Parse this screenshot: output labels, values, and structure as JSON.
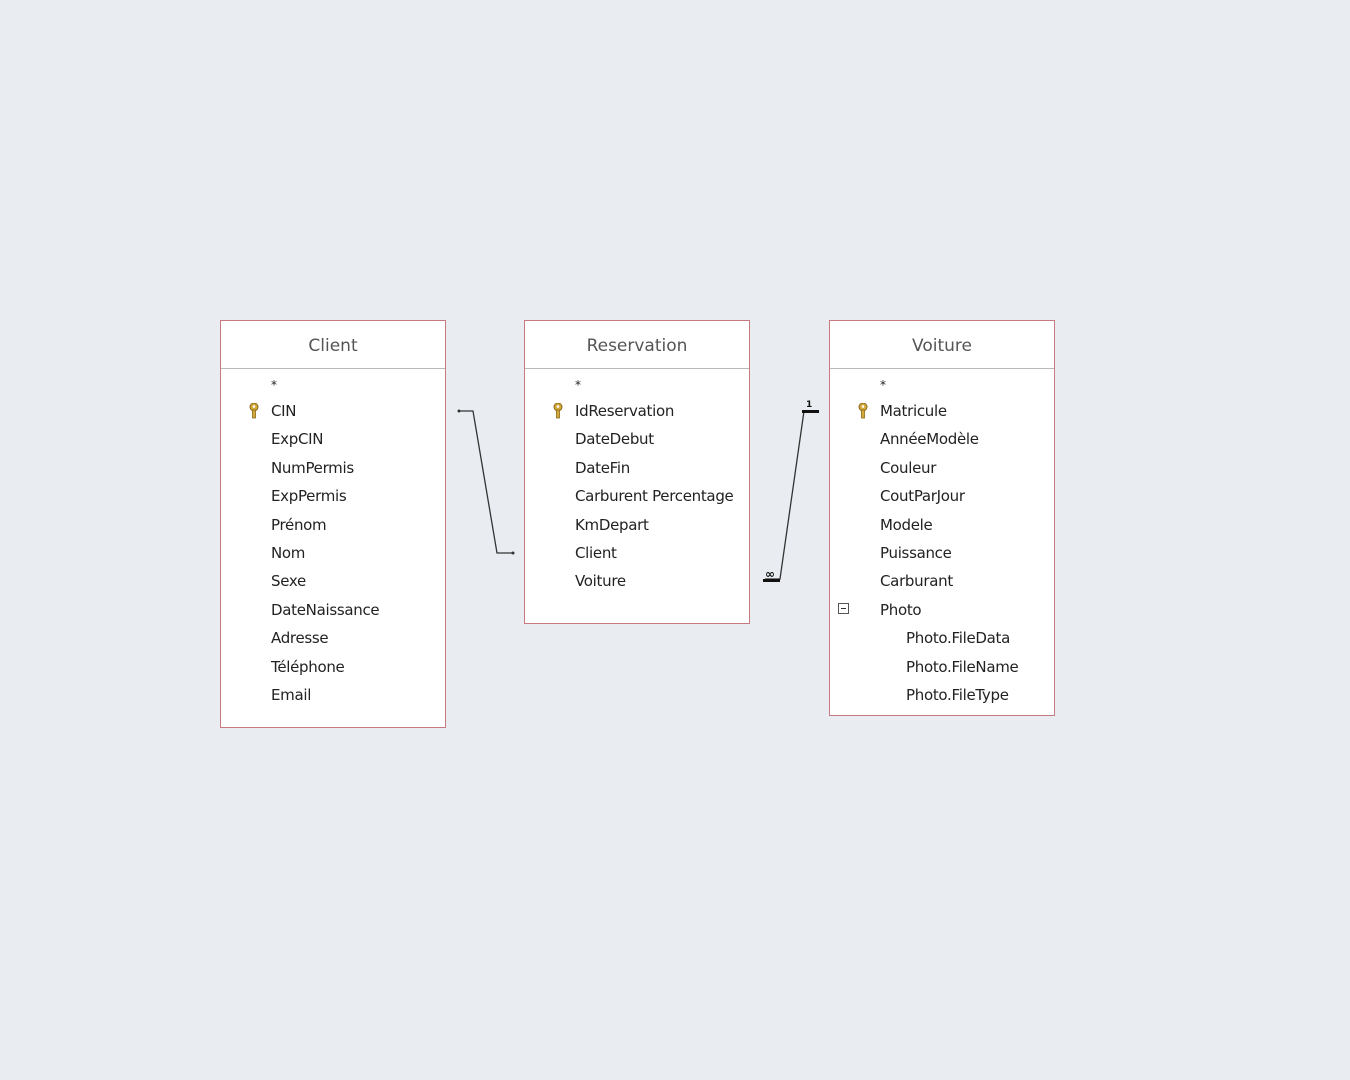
{
  "tables": [
    {
      "name": "Client",
      "fields": [
        "*",
        "CIN",
        "ExpCIN",
        "NumPermis",
        "ExpPermis",
        "Prénom",
        "Nom",
        "Sexe",
        "DateNaissance",
        "Adresse",
        "Téléphone",
        "Email"
      ],
      "primary_key": "CIN"
    },
    {
      "name": "Reservation",
      "fields": [
        "*",
        "IdReservation",
        "DateDebut",
        "DateFin",
        "Carburent Percentage",
        "KmDepart",
        "Client",
        "Voiture"
      ],
      "primary_key": "IdReservation"
    },
    {
      "name": "Voiture",
      "fields": [
        "*",
        "Matricule",
        "AnnéeModèle",
        "Couleur",
        "CoutParJour",
        "Modele",
        "Puissance",
        "Carburant",
        "Photo",
        "Photo.FileData",
        "Photo.FileName",
        "Photo.FileType"
      ],
      "primary_key": "Matricule"
    }
  ],
  "relationships": [
    {
      "from": "Client.CIN",
      "to": "Reservation.Client"
    },
    {
      "from": "Voiture.Matricule",
      "to": "Reservation.Voiture",
      "one_label": "1",
      "many_label": "∞"
    }
  ],
  "colors": {
    "background": "#e9edf2",
    "table_border": "#c97a80",
    "key_icon": "#d4a93a"
  }
}
